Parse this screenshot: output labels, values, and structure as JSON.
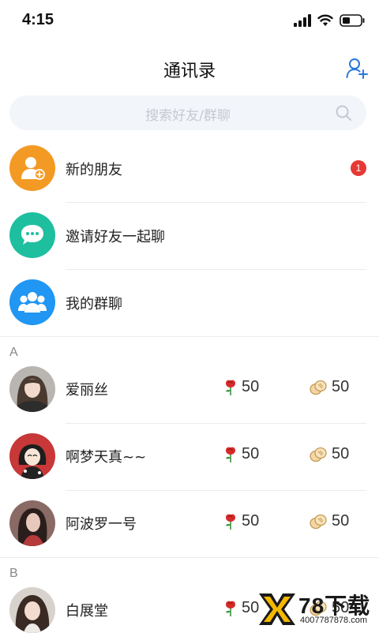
{
  "status_bar": {
    "time": "4:15"
  },
  "header": {
    "title": "通讯录"
  },
  "search": {
    "placeholder": "搜索好友/群聊"
  },
  "menu": [
    {
      "label": "新的朋友",
      "color": "#f39a25",
      "icon": "add-friend-icon",
      "badge": "1"
    },
    {
      "label": "邀请好友一起聊",
      "color": "#1dbf9f",
      "icon": "chat-bubble-icon"
    },
    {
      "label": "我的群聊",
      "color": "#2196f3",
      "icon": "group-icon"
    }
  ],
  "sections": [
    {
      "letter": "A",
      "contacts": [
        {
          "name": "爱丽丝",
          "roses": "50",
          "coins": "50"
        },
        {
          "name": "啊梦天真~~",
          "roses": "50",
          "coins": "50"
        },
        {
          "name": "阿波罗一号",
          "roses": "50",
          "coins": "50"
        }
      ]
    },
    {
      "letter": "B",
      "contacts": [
        {
          "name": "白展堂",
          "roses": "50",
          "coins": "50"
        }
      ]
    }
  ],
  "watermark": {
    "brand": "78下载",
    "site": "4007787878.com"
  }
}
